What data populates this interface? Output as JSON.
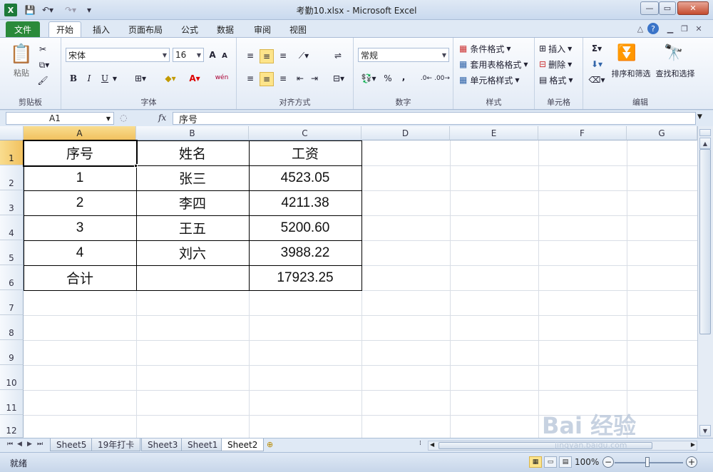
{
  "window": {
    "title": "考勤10.xlsx - Microsoft Excel",
    "app_icon": "X"
  },
  "tabs": [
    "文件",
    "开始",
    "插入",
    "页面布局",
    "公式",
    "数据",
    "审阅",
    "视图"
  ],
  "ribbon": {
    "clipboard": {
      "paste_label": "粘贴",
      "group_label": "剪贴板"
    },
    "font": {
      "name": "宋体",
      "size": "16",
      "bold": "B",
      "italic": "I",
      "underline": "U",
      "grow": "A",
      "shrink": "A",
      "phonetic": "wén",
      "group_label": "字体"
    },
    "alignment": {
      "group_label": "对齐方式"
    },
    "number": {
      "format": "常规",
      "percent": "%",
      "comma": ",",
      "group_label": "数字"
    },
    "styles": {
      "conditional": "条件格式",
      "table": "套用表格格式",
      "cell": "单元格样式",
      "group_label": "样式"
    },
    "cells": {
      "insert": "插入",
      "delete": "删除",
      "format": "格式",
      "group_label": "单元格"
    },
    "editing": {
      "sum": "Σ",
      "sort": "排序和筛选",
      "find": "查找和选择",
      "group_label": "编辑"
    }
  },
  "formula_bar": {
    "name_box": "A1",
    "fx": "fx",
    "formula": "序号"
  },
  "columns": [
    "A",
    "B",
    "C",
    "D",
    "E",
    "F",
    "G"
  ],
  "rows": [
    "1",
    "2",
    "3",
    "4",
    "5",
    "6",
    "7",
    "8",
    "9",
    "10",
    "11",
    "12"
  ],
  "cells": {
    "A1": "序号",
    "B1": "姓名",
    "C1": "工资",
    "A2": "1",
    "B2": "张三",
    "C2": "4523.05",
    "A3": "2",
    "B3": "李四",
    "C3": "4211.38",
    "A4": "3",
    "B4": "王五",
    "C4": "5200.60",
    "A5": "4",
    "B5": "刘六",
    "C5": "3988.22",
    "A6": "合计",
    "B6": "",
    "C6": "17923.25"
  },
  "sheets": [
    "Sheet5",
    "19年打卡",
    "Sheet3",
    "Sheet1",
    "Sheet2"
  ],
  "active_sheet": "Sheet2",
  "status": {
    "text": "就绪",
    "zoom": "100%"
  },
  "watermark": {
    "text": "Bai 经验",
    "sub": "jingyan.baidu.com"
  },
  "colors": {
    "selection_header": "#f1c15f",
    "file_tab": "#2a8a3a",
    "ribbon_bg": "#e3ebf6"
  }
}
